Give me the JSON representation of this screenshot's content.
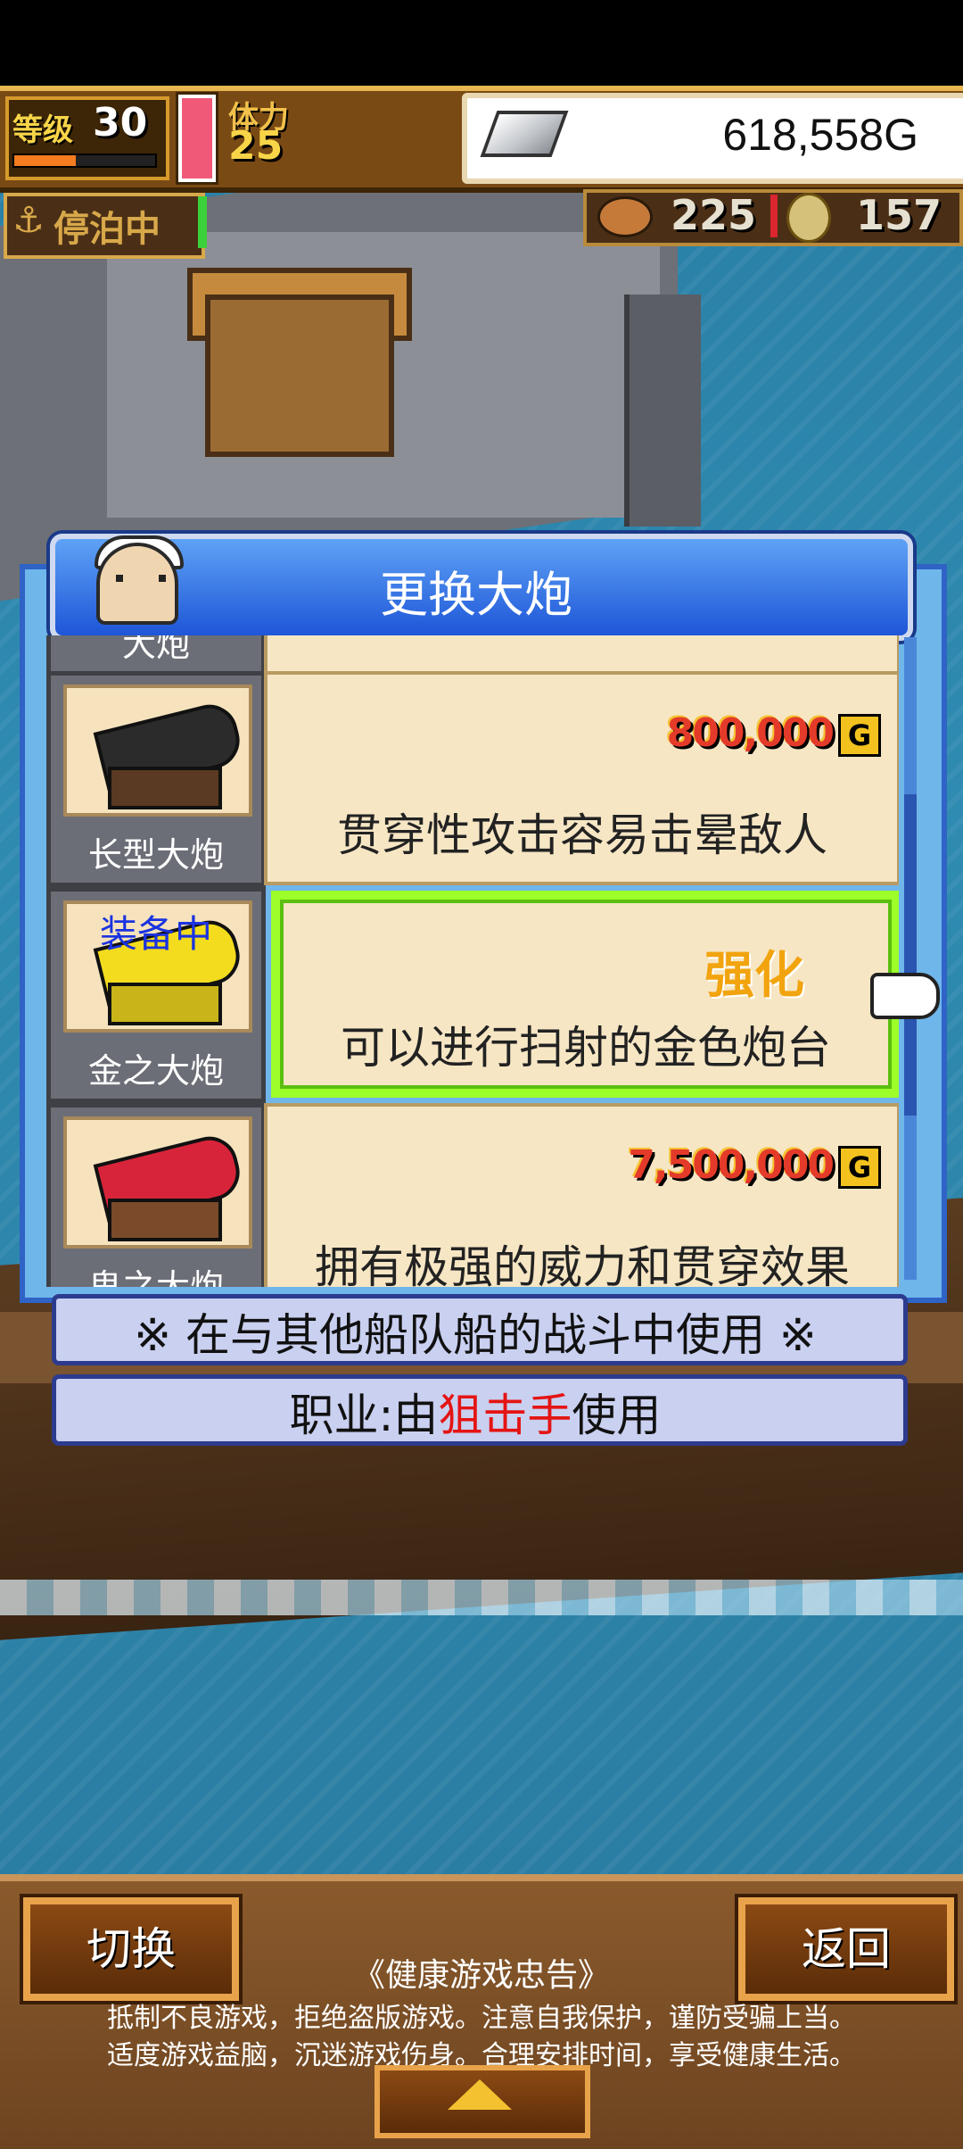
{
  "status": {
    "level_label": "等级",
    "level_value": "30",
    "level_progress": 0.45,
    "stamina_label": "体力",
    "stamina_value": "25",
    "gold": "618,558G",
    "anchor_label": "停泊中",
    "food_value": "225",
    "coin_value": "157"
  },
  "dialog": {
    "title": "更换大炮",
    "items": [
      {
        "name": "长型大炮",
        "price": "800,000",
        "currency": "G",
        "description": "贯穿性攻击容易击晕敌人"
      },
      {
        "name": "金之大炮",
        "equip_tag": "装备中",
        "action": "强化",
        "description": "可以进行扫射的金色炮台"
      },
      {
        "name": "鬼之大炮",
        "price": "7,500,000",
        "currency": "G",
        "description": "拥有极强的威力和贯穿效果"
      }
    ],
    "partial_item_name": "大炮"
  },
  "notes": {
    "battle": "※ 在与其他船队船的战斗中使用 ※",
    "job_prefix": "职业:由",
    "job_name": "狙击手",
    "job_suffix": "使用"
  },
  "bottom": {
    "switch_label": "切换",
    "back_label": "返回",
    "advice_title": "《健康游戏忠告》",
    "advice_line1": "抵制不良游戏，拒绝盗版游戏。注意自我保护，谨防受骗上当。",
    "advice_line2": "适度游戏益脑，沉迷游戏伤身。合理安排时间，享受健康生活。"
  },
  "colors": {
    "accent_blue": "#1e56d8",
    "selected_border": "#9dff2a",
    "highlight_red": "#e41414"
  }
}
